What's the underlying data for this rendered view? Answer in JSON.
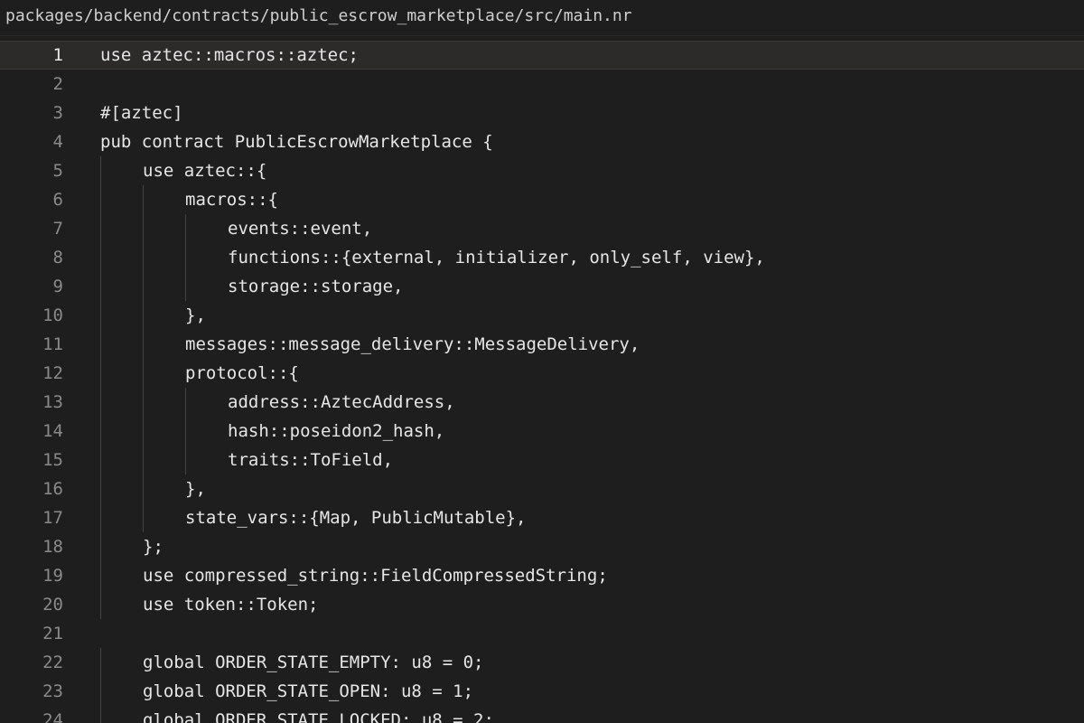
{
  "breadcrumb": "packages/backend/contracts/public_escrow_marketplace/src/main.nr",
  "editor": {
    "current_line": 1,
    "lines": [
      {
        "num": "1",
        "text": "use aztec::macros::aztec;",
        "indent": 0
      },
      {
        "num": "2",
        "text": "",
        "indent": 0
      },
      {
        "num": "3",
        "text": "#[aztec]",
        "indent": 0
      },
      {
        "num": "4",
        "text": "pub contract PublicEscrowMarketplace {",
        "indent": 0
      },
      {
        "num": "5",
        "text": "use aztec::{",
        "indent": 1
      },
      {
        "num": "6",
        "text": "macros::{",
        "indent": 2
      },
      {
        "num": "7",
        "text": "events::event,",
        "indent": 3
      },
      {
        "num": "8",
        "text": "functions::{external, initializer, only_self, view},",
        "indent": 3
      },
      {
        "num": "9",
        "text": "storage::storage,",
        "indent": 3
      },
      {
        "num": "10",
        "text": "},",
        "indent": 2
      },
      {
        "num": "11",
        "text": "messages::message_delivery::MessageDelivery,",
        "indent": 2
      },
      {
        "num": "12",
        "text": "protocol::{",
        "indent": 2
      },
      {
        "num": "13",
        "text": "address::AztecAddress,",
        "indent": 3
      },
      {
        "num": "14",
        "text": "hash::poseidon2_hash,",
        "indent": 3
      },
      {
        "num": "15",
        "text": "traits::ToField,",
        "indent": 3
      },
      {
        "num": "16",
        "text": "},",
        "indent": 2
      },
      {
        "num": "17",
        "text": "state_vars::{Map, PublicMutable},",
        "indent": 2
      },
      {
        "num": "18",
        "text": "};",
        "indent": 1
      },
      {
        "num": "19",
        "text": "use compressed_string::FieldCompressedString;",
        "indent": 1
      },
      {
        "num": "20",
        "text": "use token::Token;",
        "indent": 1
      },
      {
        "num": "21",
        "text": "",
        "indent": 0
      },
      {
        "num": "22",
        "text": "global ORDER_STATE_EMPTY: u8 = 0;",
        "indent": 1
      },
      {
        "num": "23",
        "text": "global ORDER_STATE_OPEN: u8 = 1;",
        "indent": 1
      },
      {
        "num": "24",
        "text": "global ORDER_STATE_LOCKED: u8 = 2;",
        "indent": 1
      }
    ]
  }
}
